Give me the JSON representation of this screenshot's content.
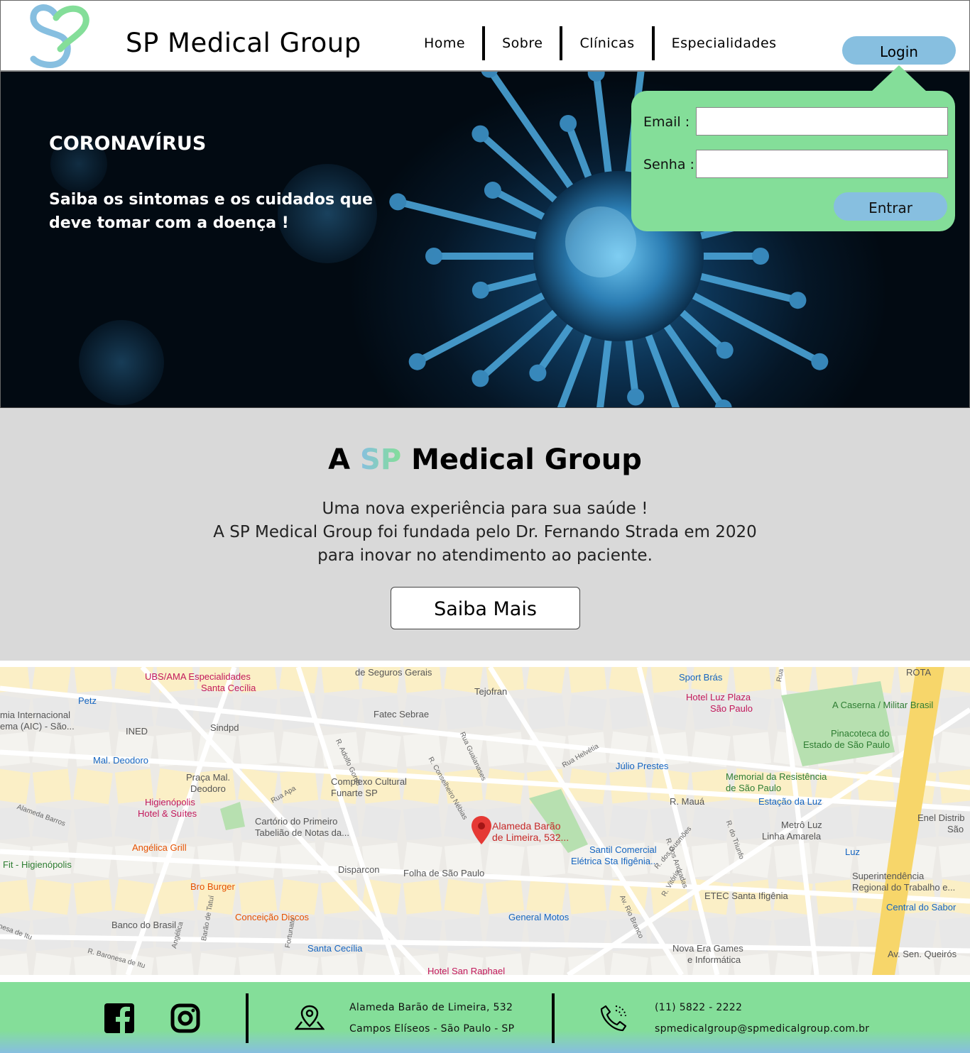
{
  "header": {
    "brand": "SP Medical Group",
    "nav": [
      "Home",
      "Sobre",
      "Clínicas",
      "Especialidades"
    ],
    "login_label": "Login"
  },
  "hero": {
    "title": "CORONAVÍRUS",
    "subtitle": "Saiba os sintomas e os cuidados que deve tomar com a doença !"
  },
  "login_popup": {
    "email_label": "Email :",
    "senha_label": "Senha :",
    "email_value": "",
    "senha_value": "",
    "submit_label": "Entrar"
  },
  "about": {
    "title_prefix": "A",
    "title_sp": "SP",
    "title_suffix": "Medical Group",
    "lines": [
      "Uma nova experiência para sua saúde !",
      "A SP Medical Group foi fundada pelo Dr. Fernando Strada em 2020",
      "para inovar no atendimento ao paciente."
    ],
    "button_label": "Saiba Mais"
  },
  "map": {
    "marker_label": "Alameda Barão de Limeira, 532...",
    "labels": [
      "UBS/AMA Especialidades",
      "Santa Cecília",
      "de Seguros Gerais",
      "Tejofran",
      "Sport Brás",
      "ROTA",
      "Petz",
      "Fatec Sebrae",
      "Hotel Luz Plaza",
      "São Paulo",
      "A Caserna / Militar Brasil",
      "mia Internacional",
      "ema (AIC) - São...",
      "INED",
      "Sindpd",
      "Pinacoteca do",
      "Estado de São Paulo",
      "Mal. Deodoro",
      "Júlio Prestes",
      "Memorial da Resistência",
      "de São Paulo",
      "Praça Mal.",
      "Deodoro",
      "Complexo Cultural",
      "Funarte SP",
      "R. Mauá",
      "Estação da Luz",
      "Higienópolis",
      "Hotel & Suítes",
      "Cartório do Primeiro",
      "Tabelião de Notas da...",
      "Metrô Luz",
      "Linha Amarela",
      "Enel Distrib",
      "São",
      "Angélica Grill",
      "Santil Comercial",
      "Elétrica Sta Ifigênia...",
      "Luz",
      "Fit - Higienópolis",
      "Disparcon",
      "Folha de São Paulo",
      "Superintendência",
      "Regional do Trabalho e...",
      "Bro Burger",
      "ETEC Santa Ifigênia",
      "Central do Sabor",
      "Conceição Discos",
      "General Motos",
      "Banco do Brasil",
      "Santa Cecília",
      "Nova Era Games",
      "e Informática",
      "Hotel San Raphael",
      "Av. Sen. Queirós"
    ],
    "streets": [
      "Rua Apa",
      "R. Adolfo Gordo",
      "R. Conselheiro Nébias",
      "Rua Guaianases",
      "Rua Helvétia",
      "Alameda Barros",
      "Av. Rio Branco",
      "R. dos Andradas",
      "R. do Triunfo",
      "R. dos Gusmões",
      "R. Vitória",
      "Rua Prates",
      "R. Baronesa de Itu",
      "Fortunato",
      "Angélica",
      "Barão de Tatuí",
      "nesa de Itu"
    ]
  },
  "footer": {
    "address_line1": "Alameda Barão de Limeira, 532",
    "address_line2": "Campos Elíseos - São Paulo - SP",
    "phone": "(11) 5822 - 2222",
    "email": "spmedicalgroup@spmedicalgroup.com.br"
  },
  "colors": {
    "green": "#84de99",
    "blue": "#87bfe0",
    "gray": "#d9d9d9"
  },
  "icons": [
    "logo-sp-heart",
    "facebook-icon",
    "instagram-icon",
    "map-pin-icon",
    "phone-icon",
    "map-marker-icon"
  ]
}
